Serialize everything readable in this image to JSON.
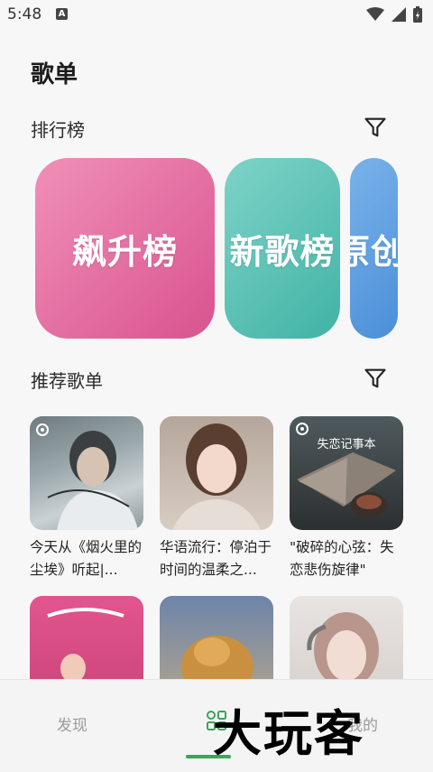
{
  "status": {
    "time": "5:48",
    "notif_letter": "A"
  },
  "page": {
    "title": "歌单"
  },
  "rankings": {
    "title": "排行榜",
    "cards": [
      {
        "label": "飙升榜",
        "color_from": "#d9538f",
        "color_to": "#f090b8"
      },
      {
        "label": "新歌榜",
        "color_from": "#40b3a6",
        "color_to": "#7fd3c7"
      },
      {
        "label": "原创",
        "color_from": "#4b8fd8",
        "color_to": "#7ab2ea"
      }
    ]
  },
  "recommended": {
    "title": "推荐歌单",
    "items": [
      {
        "caption": "今天从《烟火里的尘埃》听起|...",
        "cover_text": ""
      },
      {
        "caption": "华语流行：停泊于时间的温柔之...",
        "cover_text": ""
      },
      {
        "caption": "\"破碎的心弦：失恋悲伤旋律\"",
        "cover_text": "失恋记事本"
      },
      {
        "caption": "",
        "cover_text": ""
      },
      {
        "caption": "",
        "cover_text": ""
      },
      {
        "caption": "",
        "cover_text": ""
      }
    ]
  },
  "nav": {
    "discover": "发现",
    "mine": "我的"
  },
  "watermark": "大玩客",
  "colors": {
    "accent": "#3ba55c"
  }
}
